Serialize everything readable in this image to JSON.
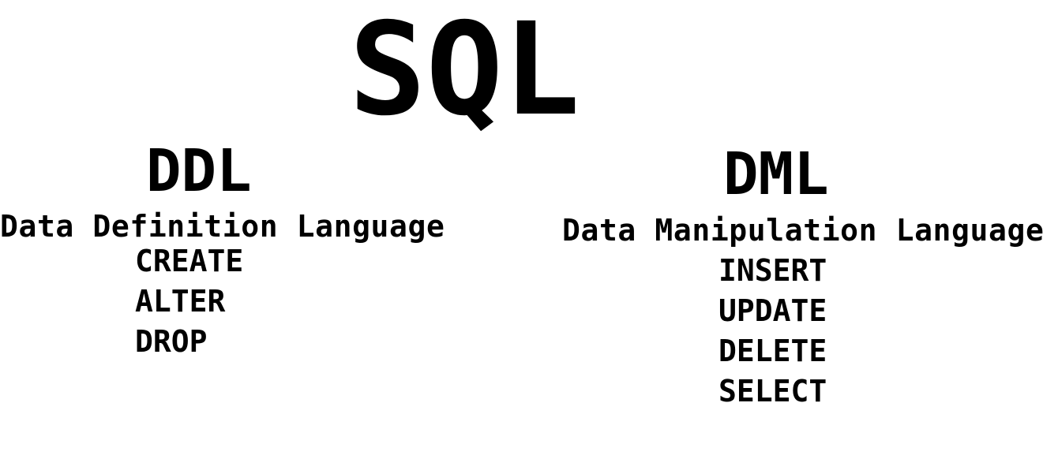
{
  "title": "SQL",
  "ddl": {
    "abbr": "DDL",
    "full_name": "Data Definition Language",
    "commands": [
      "CREATE",
      "ALTER",
      "DROP"
    ]
  },
  "dml": {
    "abbr": "DML",
    "full_name": "Data Manipulation Language",
    "commands": [
      "INSERT",
      "UPDATE",
      "DELETE",
      "SELECT"
    ]
  },
  "colors": {
    "text": "#000000",
    "background": "#ffffff"
  }
}
